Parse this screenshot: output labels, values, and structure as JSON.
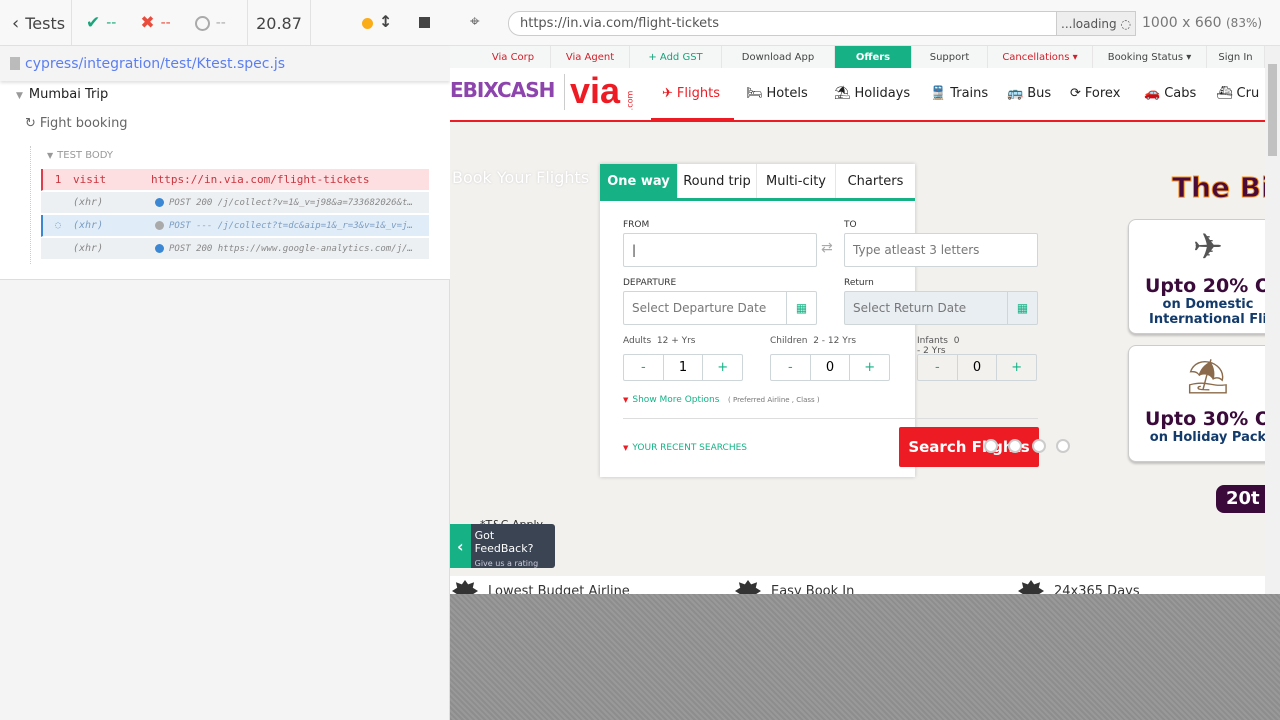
{
  "runner": {
    "back_label": "Tests",
    "passed": "--",
    "failed": "--",
    "pending": "--",
    "duration": "20.87",
    "spec_path": "cypress/integration/test/Ktest.spec.js",
    "suite": "Mumbai Trip",
    "test": "Fight booking",
    "section": "TEST BODY",
    "commands": [
      {
        "num": "1",
        "name": "visit",
        "message": "https://in.via.com/flight-tickets"
      },
      {
        "num": "",
        "name": "(xhr)",
        "message": "POST 200 /j/collect?v=1&_v=j98&a=733682026&t…"
      },
      {
        "num": "",
        "name": "(xhr)",
        "message": "POST --- /j/collect?t=dc&aip=1&_r=3&v=1&_v=j…"
      },
      {
        "num": "",
        "name": "(xhr)",
        "message": "POST 200 https://www.google-analytics.com/j/…"
      }
    ]
  },
  "browser": {
    "url": "https://in.via.com/flight-tickets",
    "loading": "...loading",
    "viewport": "1000 x 660",
    "zoom": "(83%)"
  },
  "site": {
    "top_links": [
      "Via Corp",
      "Via Agent",
      "+ Add GST",
      "Download App",
      "Offers",
      "Support",
      "Cancellations ▾",
      "Booking Status ▾",
      "Sign In"
    ],
    "logo_ebix": "EBIXCASH",
    "logo_via": "via",
    "logo_com": ".com",
    "nav": [
      {
        "icon": "plane-icon",
        "label": "Flights"
      },
      {
        "icon": "bed-icon",
        "label": "Hotels"
      },
      {
        "icon": "beach-icon",
        "label": "Holidays"
      },
      {
        "icon": "train-icon",
        "label": "Trains"
      },
      {
        "icon": "bus-icon",
        "label": "Bus"
      },
      {
        "icon": "forex-icon",
        "label": "Forex"
      },
      {
        "icon": "car-icon",
        "label": "Cabs"
      },
      {
        "icon": "ship-icon",
        "label": "Cru"
      }
    ],
    "book_title": "Book Your Flights",
    "tabs": [
      "One way",
      "Round trip",
      "Multi-city",
      "Charters"
    ],
    "from_label": "FROM",
    "to_label": "TO",
    "to_placeholder": "Type atleast 3 letters",
    "departure_label": "DEPARTURE",
    "departure_placeholder": "Select Departure Date",
    "return_label": "Return",
    "return_placeholder": "Select Return Date",
    "adults_label": "Adults",
    "adults_range": "12 + Yrs",
    "adults": "1",
    "children_label": "Children",
    "children_range": "2 - 12 Yrs",
    "children": "0",
    "infants_label": "Infants",
    "infants_range": "0 - 2 Yrs",
    "infants": "0",
    "minus": "-",
    "plus": "+",
    "more_options": "Show More Options",
    "more_options_hint": "( Preferred Airline , Class )",
    "recent": "YOUR RECENT SEARCHES",
    "search_button": "Search Flights",
    "promo_title": "The Bi",
    "promo1_big": "Upto 20% O",
    "promo1_l1": "on Domestic",
    "promo1_l2": "International Fli",
    "promo2_big": "Upto 30% O",
    "promo2_l1": "on Holiday Pack",
    "promo_badge": "20t",
    "tnc": "*T&C Apply",
    "feedback_title": "Got FeedBack?",
    "feedback_sub": "Give us a rating",
    "features": [
      "Lowest Budget Airline",
      "Easy Book In",
      "24x365 Days"
    ]
  },
  "colors": {
    "green": "#16b286",
    "red": "#ed1c24",
    "via_red": "#d0202a"
  }
}
